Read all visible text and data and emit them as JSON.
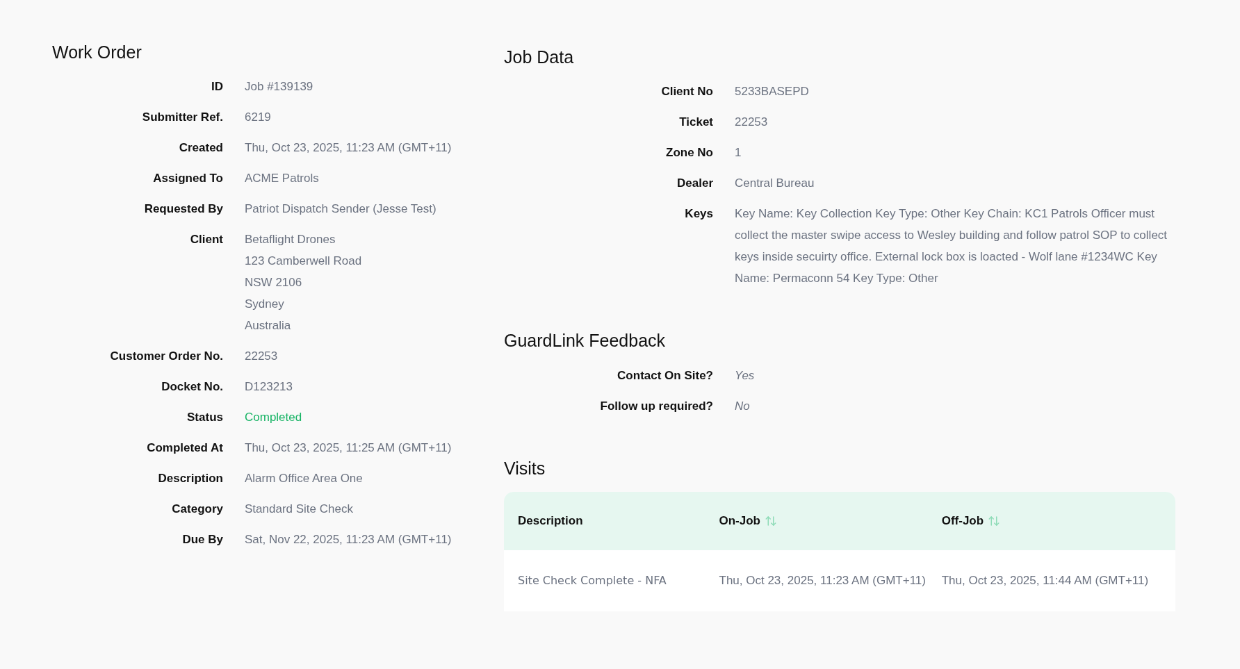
{
  "work_order": {
    "title": "Work Order",
    "fields": [
      {
        "label": "ID",
        "kind": "text",
        "value": "Job #139139"
      },
      {
        "label": "Submitter Ref.",
        "kind": "text",
        "value": "6219"
      },
      {
        "label": "Created",
        "kind": "text",
        "value": "Thu, Oct 23, 2025, 11:23 AM (GMT+11)"
      },
      {
        "label": "Assigned To",
        "kind": "text",
        "value": "ACME Patrols"
      },
      {
        "label": "Requested By",
        "kind": "text",
        "value": "Patriot Dispatch Sender (Jesse Test)"
      },
      {
        "label": "Client",
        "kind": "address",
        "lines": [
          "Betaflight Drones",
          "123 Camberwell Road",
          "NSW 2106",
          "Sydney",
          "Australia"
        ]
      },
      {
        "label": "Customer Order No.",
        "kind": "text",
        "value": "22253"
      },
      {
        "label": "Docket No.",
        "kind": "text",
        "value": "D123213"
      },
      {
        "label": "Status",
        "kind": "status",
        "value": "Completed"
      },
      {
        "label": "Completed At",
        "kind": "text",
        "value": "Thu, Oct 23, 2025, 11:25 AM (GMT+11)"
      },
      {
        "label": "Description",
        "kind": "text",
        "value": "Alarm Office Area One"
      },
      {
        "label": "Category",
        "kind": "text",
        "value": "Standard Site Check"
      },
      {
        "label": "Due By",
        "kind": "text",
        "value": "Sat, Nov 22, 2025, 11:23 AM (GMT+11)"
      }
    ]
  },
  "job_data": {
    "title": "Job Data",
    "fields": [
      {
        "label": "Client No",
        "kind": "text",
        "value": "5233BASEPD"
      },
      {
        "label": "Ticket",
        "kind": "text",
        "value": "22253"
      },
      {
        "label": "Zone No",
        "kind": "text",
        "value": "1"
      },
      {
        "label": "Dealer",
        "kind": "text",
        "value": "Central Bureau"
      },
      {
        "label": "Keys",
        "kind": "text",
        "value": "Key Name: Key Collection Key Type: Other Key Chain: KC1 Patrols Officer must collect the master swipe access to Wesley building and follow patrol SOP to collect keys inside secuirty office. External lock box is loacted - Wolf lane #1234WC   Key Name: Permaconn 54 Key Type: Other"
      }
    ]
  },
  "feedback": {
    "title": "GuardLink Feedback",
    "fields": [
      {
        "label": "Contact On Site?",
        "kind": "answer",
        "value": "Yes"
      },
      {
        "label": "Follow up required?",
        "kind": "answer",
        "value": "No"
      }
    ]
  },
  "visits": {
    "title": "Visits",
    "columns": [
      {
        "label": "Description",
        "sortable": false
      },
      {
        "label": "On-Job",
        "sortable": true
      },
      {
        "label": "Off-Job",
        "sortable": true
      }
    ],
    "rows": [
      [
        "Site Check Complete - NFA",
        "Thu, Oct 23, 2025, 11:23 AM (GMT+11)",
        "Thu, Oct 23, 2025, 11:44 AM (GMT+11)"
      ]
    ]
  }
}
